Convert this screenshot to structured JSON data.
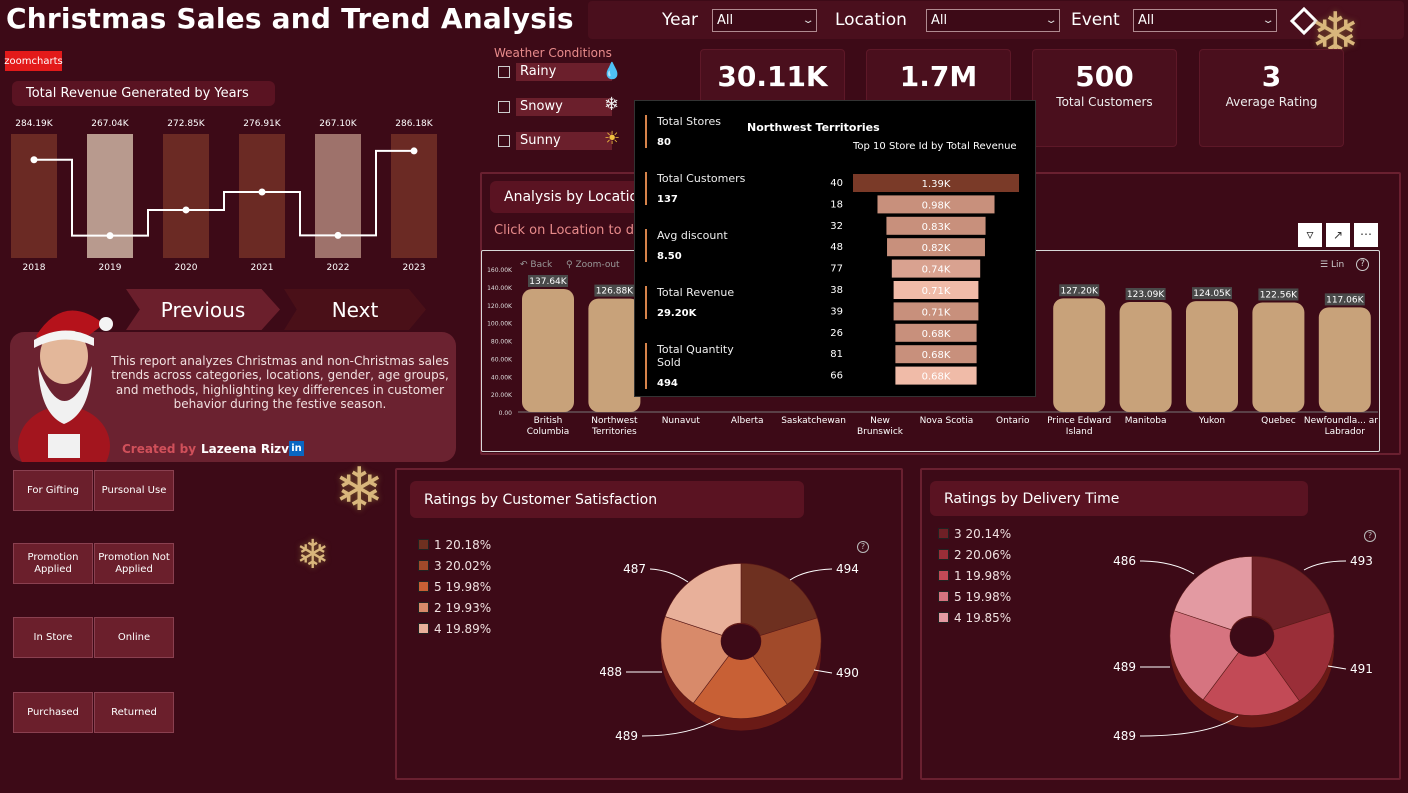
{
  "header": {
    "title": "Christmas Sales and Trend Analysis"
  },
  "filters": [
    {
      "label": "Year",
      "value": "All"
    },
    {
      "label": "Location",
      "value": "All"
    },
    {
      "label": "Event",
      "value": "All"
    }
  ],
  "brand": {
    "zoomcharts": "zoomcharts"
  },
  "weather": {
    "title": "Weather Conditions",
    "options": [
      {
        "label": "Rainy",
        "icon": "raindrop-icon"
      },
      {
        "label": "Snowy",
        "icon": "snowflake-icon"
      },
      {
        "label": "Sunny",
        "icon": "sun-icon"
      }
    ]
  },
  "kpis": [
    {
      "value": "30.11K",
      "label": ""
    },
    {
      "value": "1.7M",
      "label": ""
    },
    {
      "value": "500",
      "label": "Total Customers"
    },
    {
      "value": "3",
      "label": "Average Rating"
    }
  ],
  "revenue_chart": {
    "title": "Total Revenue Generated by Years",
    "chart_data": {
      "type": "bar",
      "categories": [
        "2018",
        "2019",
        "2020",
        "2021",
        "2022",
        "2023"
      ],
      "values": [
        284.19,
        267.04,
        272.85,
        276.91,
        267.1,
        286.18
      ],
      "labels": [
        "284.19K",
        "267.04K",
        "272.85K",
        "276.91K",
        "267.10K",
        "286.18K"
      ],
      "colors": [
        "#6b2a24",
        "#b89a8e",
        "#6b2a24",
        "#6b2a24",
        "#9e726b",
        "#6b2a24"
      ]
    }
  },
  "nav": {
    "previous": "Previous",
    "next": "Next"
  },
  "description": {
    "text": "This report analyzes Christmas and non-Christmas sales trends across categories, locations, gender, age groups, and methods, highlighting key differences in customer behavior during the festive season.",
    "created_by_label": "Created by",
    "author": "Lazeena Rizvi",
    "linkedin": "in"
  },
  "slicers": [
    [
      "For Gifting",
      "Pursonal Use"
    ],
    [
      "Promotion Applied",
      "Promotion Not Applied"
    ],
    [
      "In Store",
      "Online"
    ],
    [
      "Purchased",
      "Returned"
    ]
  ],
  "location_chart": {
    "title": "Analysis by Locatio",
    "subtitle": "Click on Location to dril",
    "toolbar": {
      "back": "Back",
      "zoom_out": "Zoom-out",
      "scale": "Lin"
    },
    "chart_data": {
      "type": "bar",
      "y_ticks": [
        "160.00K",
        "140.00K",
        "120.00K",
        "100.00K",
        "80.00K",
        "60.00K",
        "40.00K",
        "20.00K",
        "0.00"
      ],
      "categories": [
        "British Columbia",
        "Northwest Territories",
        "Nunavut",
        "Alberta",
        "Saskatchewan",
        "New Brunswick",
        "Nova Scotia",
        "Ontario",
        "Prince Edward Island",
        "Manitoba",
        "Yukon",
        "Quebec",
        "Newfoundla... and Labrador"
      ],
      "values": [
        137.64,
        126.88,
        null,
        null,
        null,
        null,
        null,
        null,
        127.2,
        123.09,
        124.05,
        122.56,
        117.06
      ],
      "labels": [
        "137.64K",
        "126.88K",
        "",
        "",
        "",
        "",
        "",
        "",
        "127.20K",
        "123.09K",
        "124.05K",
        "122.56K",
        "117.06K"
      ]
    }
  },
  "tooltip": {
    "region": "Northwest Territories",
    "subtitle": "Top 10 Store Id  by Total Revenue",
    "stats": [
      {
        "label": "Total Stores",
        "value": "80"
      },
      {
        "label": "Total Customers",
        "value": "137"
      },
      {
        "label": "Avg discount",
        "value": "8.50"
      },
      {
        "label": "Total Revenue",
        "value": "29.20K"
      },
      {
        "label": "Total Quantity Sold",
        "value": "494"
      }
    ],
    "chart_data": {
      "type": "bar",
      "categories": [
        "40",
        "18",
        "32",
        "48",
        "77",
        "38",
        "39",
        "26",
        "81",
        "66"
      ],
      "values": [
        1.39,
        0.98,
        0.83,
        0.82,
        0.74,
        0.71,
        0.71,
        0.68,
        0.68,
        0.68
      ],
      "labels": [
        "1.39K",
        "0.98K",
        "0.83K",
        "0.82K",
        "0.74K",
        "0.71K",
        "0.71K",
        "0.68K",
        "0.68K",
        "0.68K"
      ],
      "colors": [
        "#7a3a28",
        "#c8907c",
        "#c8907c",
        "#c8907c",
        "#d9a290",
        "#f0bba8",
        "#c8907c",
        "#c8907c",
        "#c8907c",
        "#f0bba8"
      ]
    }
  },
  "satisfaction_chart": {
    "title": "Ratings by Customer Satisfaction",
    "chart_data": {
      "type": "pie",
      "legend": [
        "1 20.18%",
        "3 20.02%",
        "5 19.98%",
        "2 19.93%",
        "4 19.89%"
      ],
      "values": [
        494,
        490,
        489,
        488,
        487
      ],
      "labels": [
        "494",
        "490",
        "489",
        "488",
        "487"
      ],
      "colors": [
        "#6e3020",
        "#a14a2a",
        "#c86035",
        "#d88a6a",
        "#e8b09a"
      ]
    }
  },
  "delivery_chart": {
    "title": "Ratings by Delivery Time",
    "chart_data": {
      "type": "pie",
      "legend": [
        "3 20.14%",
        "2 20.06%",
        "1 19.98%",
        "5 19.98%",
        "4 19.85%"
      ],
      "values": [
        493,
        491,
        489,
        489,
        486
      ],
      "labels": [
        "493",
        "491",
        "489",
        "489",
        "486"
      ],
      "colors": [
        "#6e2026",
        "#9a2e38",
        "#c24a56",
        "#d67480",
        "#e39aa2"
      ]
    }
  }
}
